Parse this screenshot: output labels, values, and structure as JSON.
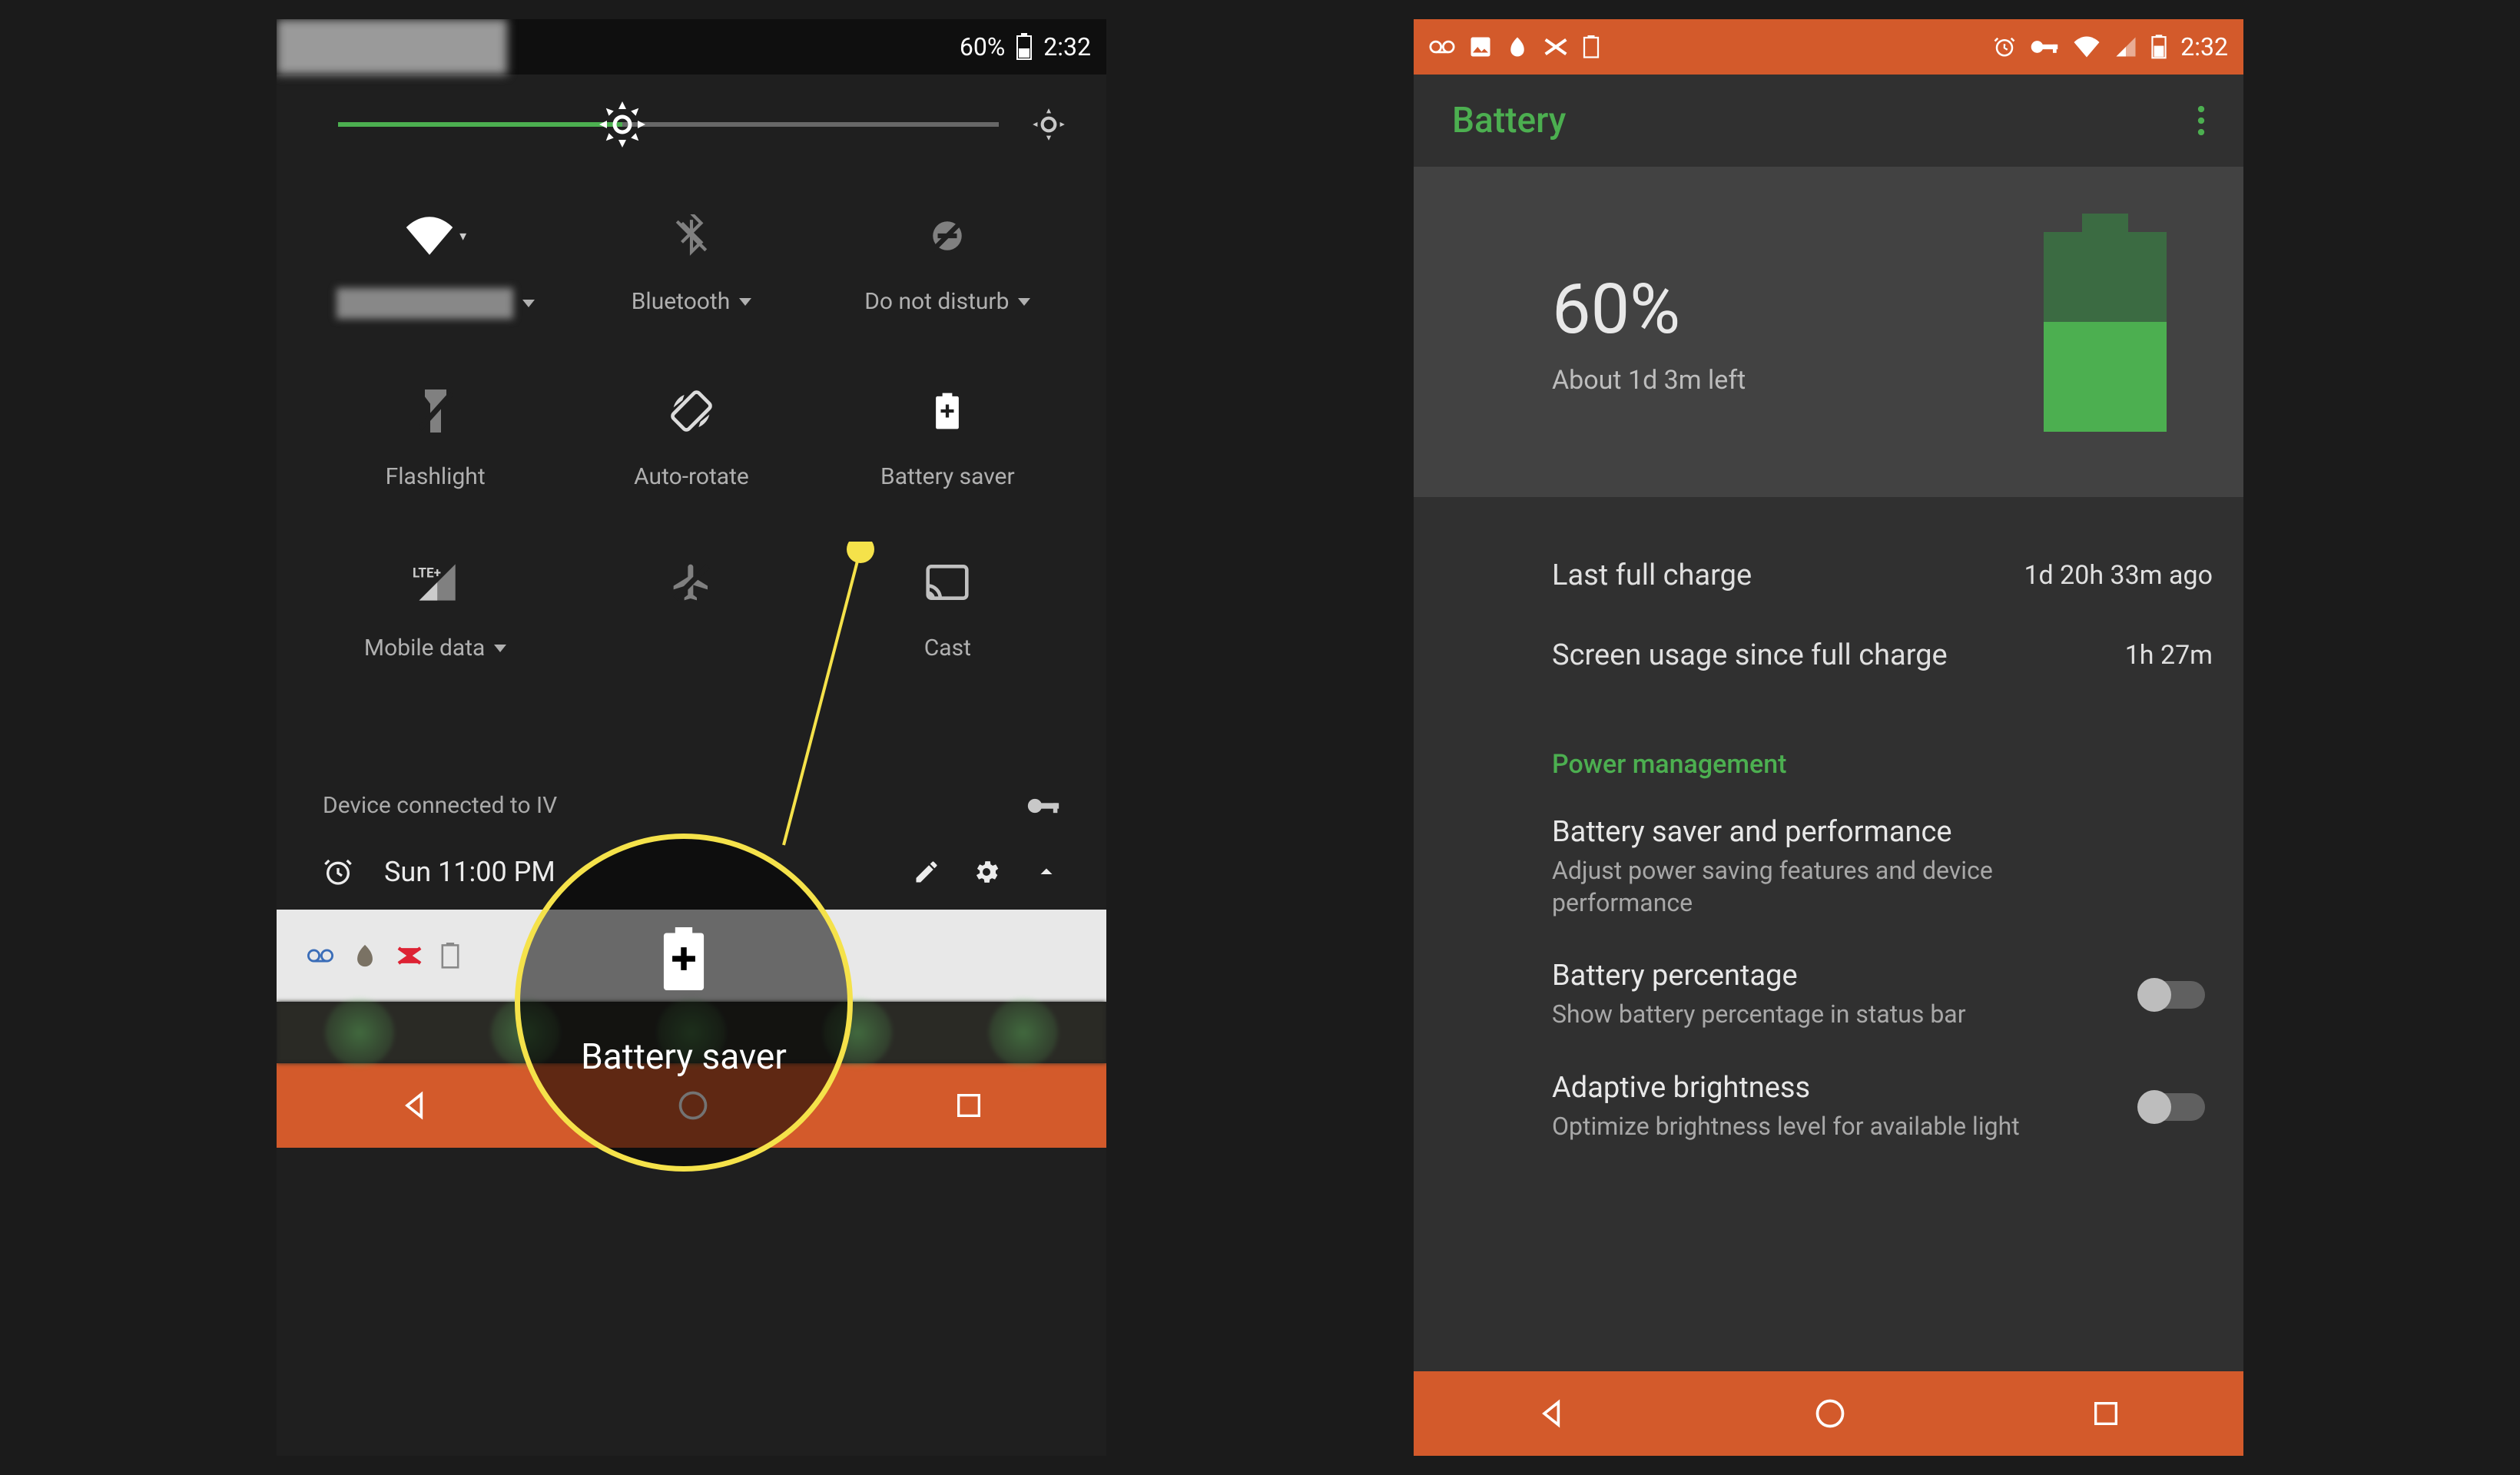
{
  "left": {
    "statusbar": {
      "battery": "60%",
      "time": "2:32"
    },
    "brightness": {
      "value_pct": 43
    },
    "tiles": [
      {
        "id": "wifi",
        "label_hidden": true,
        "dropdown": true,
        "icon": "wifi"
      },
      {
        "id": "bluetooth",
        "label": "Bluetooth",
        "dropdown": true,
        "icon": "bluetooth-off"
      },
      {
        "id": "dnd",
        "label": "Do not disturb",
        "dropdown": true,
        "icon": "dnd-off"
      },
      {
        "id": "flashlight",
        "label": "Flashlight",
        "icon": "flashlight-off"
      },
      {
        "id": "autorotate",
        "label": "Auto-rotate",
        "icon": "rotate"
      },
      {
        "id": "battery-saver",
        "label": "Battery saver",
        "icon": "battery-saver",
        "active": true
      },
      {
        "id": "mobile-data",
        "label": "Mobile data",
        "dropdown": true,
        "icon": "signal-lte"
      },
      {
        "id": "airplane",
        "label": "",
        "icon": "airplane-off"
      },
      {
        "id": "cast",
        "label": "Cast",
        "icon": "cast"
      }
    ],
    "device_info": "Device connected to IV",
    "alarm": "Sun 11:00 PM",
    "callout": {
      "label": "Battery saver"
    },
    "accent": "#d35a2b"
  },
  "right": {
    "statusbar": {
      "time": "2:32"
    },
    "appbar": {
      "title": "Battery"
    },
    "summary": {
      "pct": "60%",
      "sub": "About 1d 3m left",
      "fill_pct": 55
    },
    "rows": [
      {
        "label": "Last full charge",
        "value": "1d 20h 33m ago"
      },
      {
        "label": "Screen usage since full charge",
        "value": "1h 27m"
      }
    ],
    "section_header": "Power management",
    "settings": [
      {
        "primary": "Battery saver and performance",
        "secondary": "Adjust power saving features and device performance",
        "toggle": false
      },
      {
        "primary": "Battery percentage",
        "secondary": "Show battery percentage in status bar",
        "toggle": true,
        "on": false
      },
      {
        "primary": "Adaptive brightness",
        "secondary": "Optimize brightness level for available light",
        "toggle": true,
        "on": false
      }
    ],
    "accent_green": "#4caf50"
  }
}
